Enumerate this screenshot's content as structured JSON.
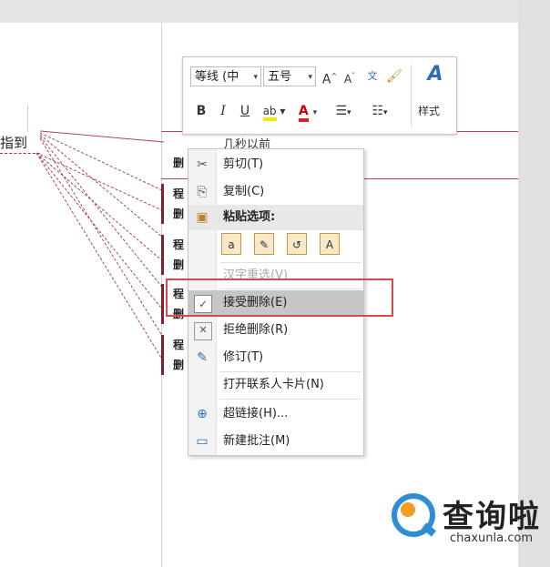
{
  "document": {
    "left_text": "指到",
    "balloon_header": "几秒以前",
    "balloon_items": [
      {
        "label": "删"
      },
      {
        "label": "程"
      },
      {
        "label": "删"
      },
      {
        "label": "程"
      },
      {
        "label": "删"
      },
      {
        "label": "程"
      },
      {
        "label": "删"
      },
      {
        "label": "程"
      },
      {
        "label": "删"
      }
    ]
  },
  "mini_toolbar": {
    "font_name": "等线 (中",
    "font_size": "五号",
    "bold": "B",
    "italic": "I",
    "underline": "U",
    "style_label": "样式"
  },
  "context_menu": {
    "items": [
      {
        "label": "剪切(T)",
        "icon": "scissors-icon",
        "glyph": "✂",
        "state": "normal"
      },
      {
        "label": "复制(C)",
        "icon": "copy-icon",
        "glyph": "⎘",
        "state": "normal"
      },
      {
        "label": "粘贴选项:",
        "icon": "clipboard-icon",
        "glyph": "📋",
        "state": "header"
      },
      {
        "label": "汉字重选(V)",
        "icon": "",
        "glyph": "",
        "state": "disabled"
      },
      {
        "label": "接受删除(E)",
        "icon": "accept-check-icon",
        "glyph": "☑",
        "state": "highlighted"
      },
      {
        "label": "拒绝删除(R)",
        "icon": "reject-x-icon",
        "glyph": "☒",
        "state": "normal"
      },
      {
        "label": "修订(T)",
        "icon": "track-changes-icon",
        "glyph": "✎",
        "state": "normal"
      },
      {
        "label": "打开联系人卡片(N)",
        "icon": "",
        "glyph": "",
        "state": "normal"
      },
      {
        "label": "超链接(H)...",
        "icon": "hyperlink-icon",
        "glyph": "🌐",
        "state": "normal"
      },
      {
        "label": "新建批注(M)",
        "icon": "new-comment-icon",
        "glyph": "🗨",
        "state": "normal"
      }
    ],
    "paste_options": [
      {
        "icon": "paste-keep-source-icon",
        "glyph": "a"
      },
      {
        "icon": "paste-merge-format-icon",
        "glyph": "✎"
      },
      {
        "icon": "paste-picture-icon",
        "glyph": "↺"
      },
      {
        "icon": "paste-text-only-icon",
        "glyph": "A"
      }
    ]
  },
  "watermark": {
    "name": "查询啦",
    "domain": "chaxunla.com"
  },
  "colors": {
    "track_change_red": "#8b1c2c",
    "highlight_box": "#d64a4a",
    "menu_hover": "#c6c6c6"
  }
}
